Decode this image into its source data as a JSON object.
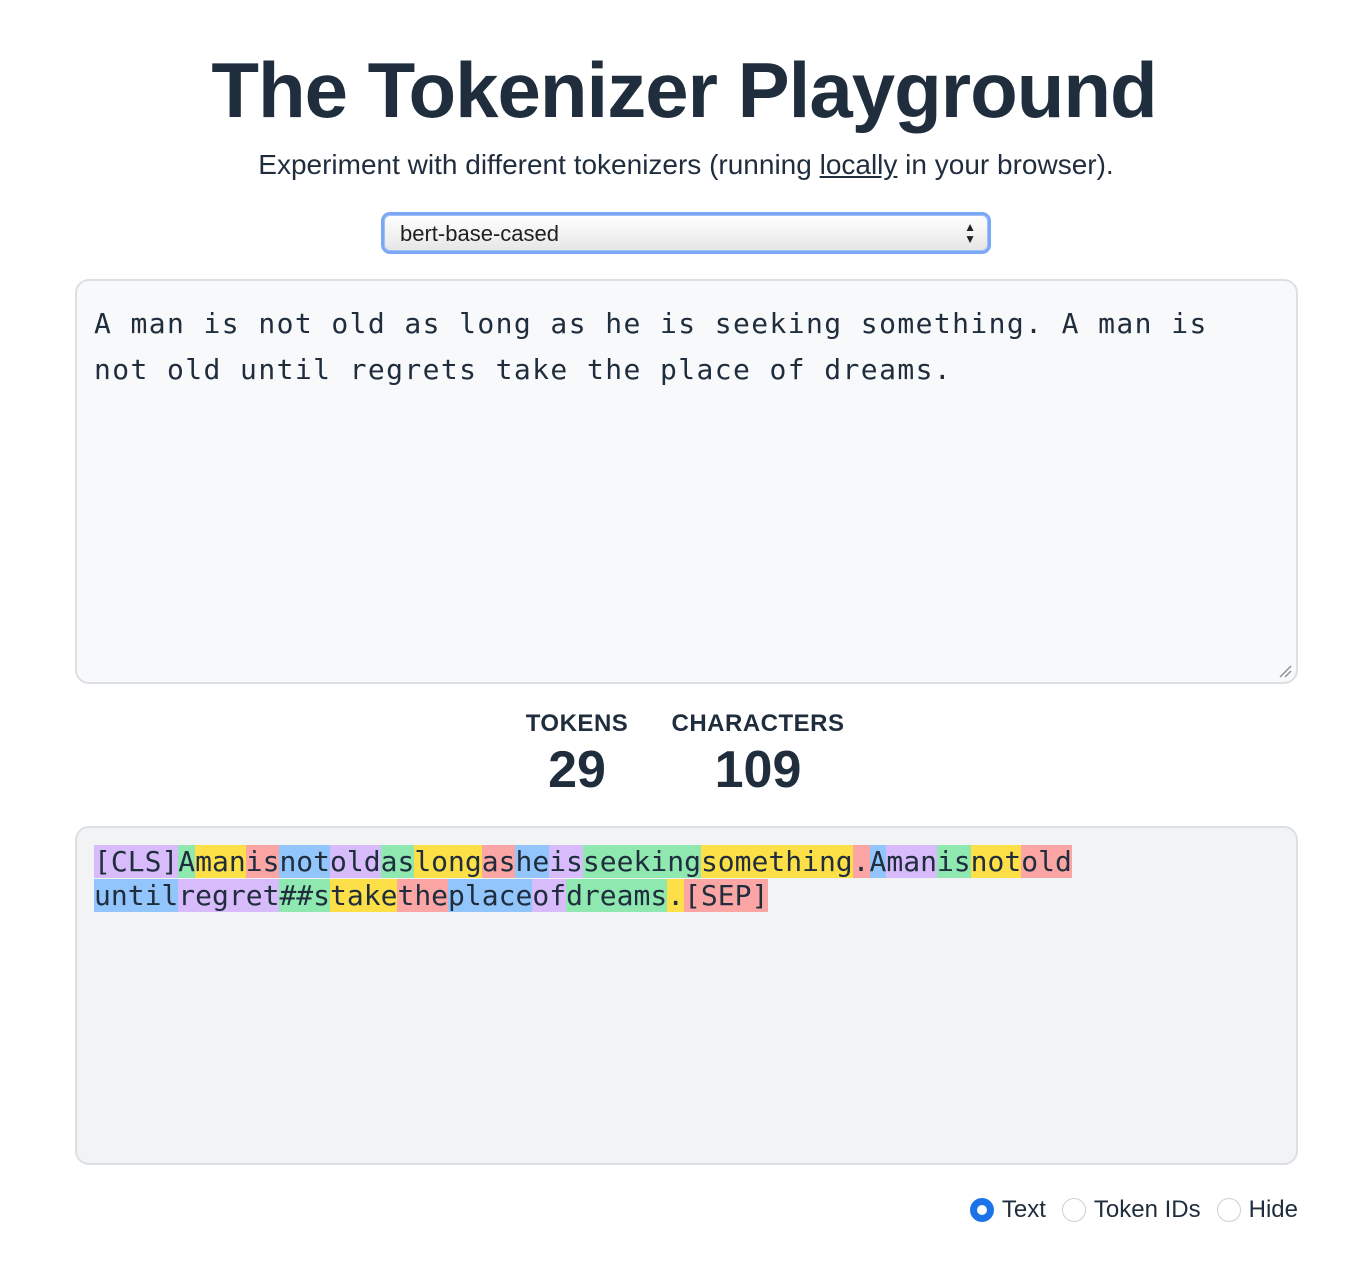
{
  "header": {
    "title": "The Tokenizer Playground",
    "subtitle_before": "Experiment with different tokenizers (running ",
    "subtitle_link": "locally",
    "subtitle_after": " in your browser)."
  },
  "model_select": {
    "selected": "bert-base-cased"
  },
  "input": {
    "text": "A man is not old as long as he is seeking something. A man is not old until regrets take the place of dreams."
  },
  "stats": {
    "tokens_label": "TOKENS",
    "tokens_value": "29",
    "characters_label": "CHARACTERS",
    "characters_value": "109"
  },
  "token_colors": [
    "#d8bbfb",
    "#8ee8b0",
    "#fde047",
    "#fca5a5",
    "#93c5fd"
  ],
  "output_tokens": [
    {
      "text": "[CLS]",
      "color": 0
    },
    {
      "text": "A",
      "color": 1
    },
    {
      "text": "man",
      "color": 2
    },
    {
      "text": "is",
      "color": 3
    },
    {
      "text": "not",
      "color": 4
    },
    {
      "text": "old",
      "color": 0
    },
    {
      "text": "as",
      "color": 1
    },
    {
      "text": "long",
      "color": 2
    },
    {
      "text": "as",
      "color": 3
    },
    {
      "text": "he",
      "color": 4
    },
    {
      "text": "is",
      "color": 0
    },
    {
      "text": "seeking",
      "color": 1
    },
    {
      "text": "something",
      "color": 2
    },
    {
      "text": ".",
      "color": 3
    },
    {
      "text": "A",
      "color": 4
    },
    {
      "text": "man",
      "color": 0
    },
    {
      "text": "is",
      "color": 1
    },
    {
      "text": "not",
      "color": 2
    },
    {
      "text": "old",
      "color": 3
    },
    {
      "text": "until",
      "color": 4
    },
    {
      "text": "regret",
      "color": 0
    },
    {
      "text": "##s",
      "color": 1
    },
    {
      "text": "take",
      "color": 2
    },
    {
      "text": "the",
      "color": 3
    },
    {
      "text": "place",
      "color": 4
    },
    {
      "text": "of",
      "color": 0
    },
    {
      "text": "dreams",
      "color": 1
    },
    {
      "text": ".",
      "color": 2
    },
    {
      "text": "[SEP]",
      "color": 3
    }
  ],
  "display_mode": {
    "options": [
      "Text",
      "Token IDs",
      "Hide"
    ],
    "selected": "Text"
  }
}
